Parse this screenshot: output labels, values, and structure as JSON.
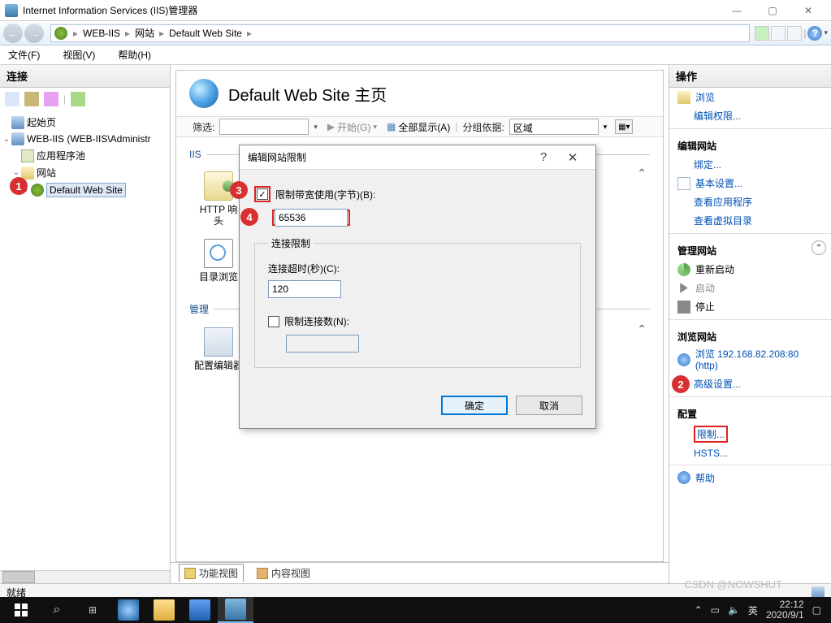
{
  "window": {
    "title": "Internet Information Services (IIS)管理器"
  },
  "breadcrumb": {
    "root": "WEB-IIS",
    "site_folder": "网站",
    "site": "Default Web Site"
  },
  "menu": {
    "file": "文件(F)",
    "view": "视图(V)",
    "help": "帮助(H)"
  },
  "left": {
    "header": "连接",
    "start": "起始页",
    "server": "WEB-IIS (WEB-IIS\\Administr",
    "apppool": "应用程序池",
    "sites": "网站",
    "defaultsite": "Default Web Site"
  },
  "center": {
    "title": "Default Web Site 主页",
    "filter_label": "筛选:",
    "go": "开始(G)",
    "showall": "全部显示(A)",
    "groupby_label": "分组依据:",
    "groupby_value": "区域",
    "group_iis": "IIS",
    "group_mgmt": "管理",
    "icon_http1": "HTTP 响",
    "icon_http2": "头",
    "icon_dir": "目录浏览",
    "icon_cfg": "配置编辑器",
    "tab_feature": "功能视图",
    "tab_content": "内容视图"
  },
  "dialog": {
    "title": "编辑网站限制",
    "help": "?",
    "chk_bw": "限制带宽使用(字节)(B):",
    "bw_value": "65536",
    "fs_conn": "连接限制",
    "timeout_label": "连接超时(秒)(C):",
    "timeout_value": "120",
    "chk_conn": "限制连接数(N):",
    "ok": "确定",
    "cancel": "取消"
  },
  "right": {
    "header": "操作",
    "browse": "浏览",
    "editperm": "编辑权限...",
    "h_editsite": "编辑网站",
    "bind": "绑定...",
    "basic": "基本设置...",
    "viewapp": "查看应用程序",
    "viewvdir": "查看虚拟目录",
    "h_mgsite": "管理网站",
    "restart": "重新启动",
    "start": "启动",
    "stop": "停止",
    "h_browsesite": "浏览网站",
    "browseurl": "浏览 192.168.82.208:80 (http)",
    "adv": "高级设置...",
    "h_config": "配置",
    "limit": "限制...",
    "hsts": "HSTS...",
    "help": "帮助"
  },
  "status": {
    "ready": "就绪"
  },
  "tray": {
    "ime": "英",
    "time": "22:12",
    "date": "2020/9/1"
  },
  "watermark": "CSDN @NOWSHUT",
  "badges": {
    "b1": "1",
    "b2": "2",
    "b3": "3",
    "b4": "4"
  }
}
